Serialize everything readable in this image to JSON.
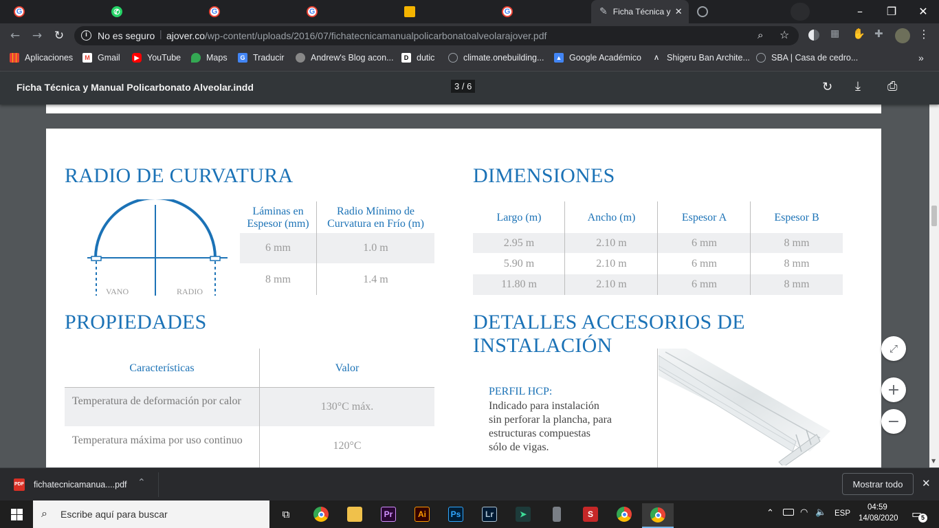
{
  "browser": {
    "active_tab_title": "Ficha Técnica y",
    "security_label": "No es seguro",
    "url_domain": "ajover.co",
    "url_path": "/wp-content/uploads/2016/07/fichatecnicamanualpolicarbonatoalveolarajover.pdf"
  },
  "bookmarks": [
    {
      "label": "Aplicaciones",
      "icon": "apps-grid-icon"
    },
    {
      "label": "Gmail",
      "icon": "gmail-icon"
    },
    {
      "label": "YouTube",
      "icon": "youtube-icon"
    },
    {
      "label": "Maps",
      "icon": "maps-icon"
    },
    {
      "label": "Traducir",
      "icon": "translate-icon"
    },
    {
      "label": "Andrew's Blog acon...",
      "icon": "avatar-icon"
    },
    {
      "label": "dutic",
      "icon": "dutic-icon"
    },
    {
      "label": "climate.onebuilding...",
      "icon": "globe-icon"
    },
    {
      "label": "Google Académico",
      "icon": "scholar-icon"
    },
    {
      "label": "Shigeru Ban Archite...",
      "icon": "sb-icon"
    },
    {
      "label": "SBA | Casa de cedro...",
      "icon": "globe-icon"
    }
  ],
  "pdf": {
    "title": "Ficha Técnica y Manual Policarbonato Alveolar.indd",
    "page_current": "3",
    "page_sep": "/",
    "page_total": "6"
  },
  "radio": {
    "heading": "RADIO DE CURVATURA",
    "label_vano": "VANO",
    "label_radio": "RADIO",
    "col1": "Láminas en Espesor (mm)",
    "col2": "Radio Mínimo de Curvatura en Frío (m)",
    "rows": [
      [
        "6 mm",
        "1.0 m"
      ],
      [
        "8 mm",
        "1.4 m"
      ]
    ]
  },
  "dimensiones": {
    "heading": "DIMENSIONES",
    "headers": [
      "Largo (m)",
      "Ancho (m)",
      "Espesor A",
      "Espesor B"
    ],
    "rows": [
      [
        "2.95 m",
        "2.10 m",
        "6 mm",
        "8 mm"
      ],
      [
        "5.90 m",
        "2.10 m",
        "6 mm",
        "8 mm"
      ],
      [
        "11.80 m",
        "2.10 m",
        "6 mm",
        "8 mm"
      ]
    ]
  },
  "propiedades": {
    "heading": "PROPIEDADES",
    "headers": [
      "Características",
      "Valor"
    ],
    "rows": [
      [
        "Temperatura de deformación por calor",
        "130°C máx."
      ],
      [
        "Temperatura máxima por uso continuo",
        "120°C"
      ]
    ]
  },
  "detalles": {
    "heading": "DETALLES ACCESORIOS DE INSTALACIÓN",
    "perfil_title": "PERFIL HCP:",
    "perfil_lines": [
      "Indicado para instalación",
      "sin perforar la plancha, para",
      "estructuras compuestas",
      "sólo de vigas."
    ]
  },
  "download": {
    "filename": "fichatecnicamanua....pdf",
    "show_all": "Mostrar todo"
  },
  "taskbar": {
    "search_placeholder": "Escribe aquí para buscar",
    "lang": "ESP",
    "time": "04:59",
    "date": "14/08/2020",
    "notifications": "5"
  },
  "colors": {
    "accent_blue": "#1b72b6",
    "table_gray": "#eeeff1"
  }
}
